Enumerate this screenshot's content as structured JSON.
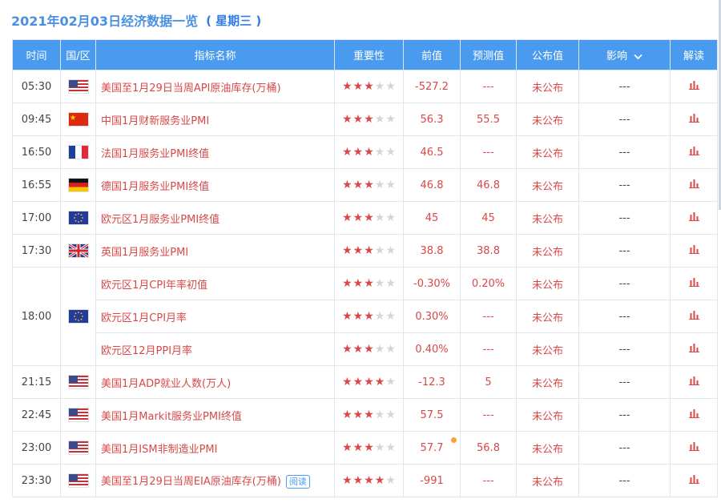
{
  "header": {
    "title": "2021年02月03日经济数据一览",
    "weekday": "( 星期三 )"
  },
  "table": {
    "columns": [
      "时间",
      "国/区",
      "指标名称",
      "重要性",
      "前值",
      "预测值",
      "公布值",
      "影响",
      "解读"
    ],
    "rows": [
      {
        "time": "05:30",
        "flag": "us",
        "name": "美国至1月29日当周API原油库存(万桶)",
        "stars": 3,
        "prev": "-527.2",
        "forecast": "---",
        "actual": "未公布",
        "impact": "---"
      },
      {
        "time": "09:45",
        "flag": "cn",
        "name": "中国1月财新服务业PMI",
        "stars": 3,
        "prev": "56.3",
        "forecast": "55.5",
        "actual": "未公布",
        "impact": "---"
      },
      {
        "time": "16:50",
        "flag": "fr",
        "name": "法国1月服务业PMI终值",
        "stars": 3,
        "prev": "46.5",
        "forecast": "---",
        "actual": "未公布",
        "impact": "---"
      },
      {
        "time": "16:55",
        "flag": "de",
        "name": "德国1月服务业PMI终值",
        "stars": 3,
        "prev": "46.8",
        "forecast": "46.8",
        "actual": "未公布",
        "impact": "---"
      },
      {
        "time": "17:00",
        "flag": "eu",
        "name": "欧元区1月服务业PMI终值",
        "stars": 3,
        "prev": "45",
        "forecast": "45",
        "actual": "未公布",
        "impact": "---"
      },
      {
        "time": "17:30",
        "flag": "uk",
        "name": "英国1月服务业PMI",
        "stars": 3,
        "prev": "38.8",
        "forecast": "38.8",
        "actual": "未公布",
        "impact": "---"
      },
      {
        "time": "18:00",
        "flag": "eu",
        "name": "欧元区1月CPI年率初值",
        "stars": 3,
        "prev": "-0.30%",
        "forecast": "0.20%",
        "actual": "未公布",
        "impact": "---"
      },
      {
        "time": "",
        "flag": "",
        "name": "欧元区1月CPI月率",
        "stars": 3,
        "prev": "0.30%",
        "forecast": "---",
        "actual": "未公布",
        "impact": "---"
      },
      {
        "time": "",
        "flag": "",
        "name": "欧元区12月PPI月率",
        "stars": 3,
        "prev": "0.40%",
        "forecast": "---",
        "actual": "未公布",
        "impact": "---"
      },
      {
        "time": "21:15",
        "flag": "us",
        "name": "美国1月ADP就业人数(万人)",
        "stars": 4,
        "prev": "-12.3",
        "forecast": "5",
        "actual": "未公布",
        "impact": "---"
      },
      {
        "time": "22:45",
        "flag": "us",
        "name": "美国1月Markit服务业PMI终值",
        "stars": 3,
        "prev": "57.5",
        "forecast": "---",
        "actual": "未公布",
        "impact": "---"
      },
      {
        "time": "23:00",
        "flag": "us",
        "name": "美国1月ISM非制造业PMI",
        "stars": 3,
        "prev": "57.7",
        "forecast": "56.8",
        "actual": "未公布",
        "impact": "---",
        "revised": true
      },
      {
        "time": "23:30",
        "flag": "us",
        "name": "美国至1月29日当周EIA原油库存(万桶)",
        "stars": 4,
        "prev": "-991",
        "forecast": "---",
        "actual": "未公布",
        "impact": "---",
        "badge": "阅读"
      }
    ]
  },
  "colors": {
    "header_bg": "#4a9bf0",
    "accent_red": "#d94848",
    "title_blue": "#4a90e2"
  },
  "icons": {
    "sort": "chevron-down-icon",
    "analysis": "bar-chart-icon",
    "importance": "star-icon"
  }
}
